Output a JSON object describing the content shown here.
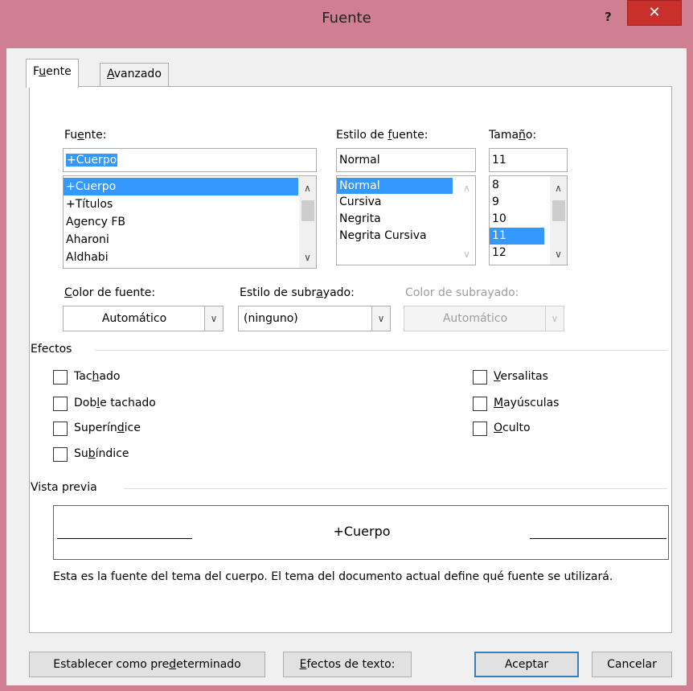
{
  "window": {
    "title": "Fuente",
    "help_label": "?",
    "close_label": "✕"
  },
  "tabs": [
    {
      "label_pre": "F",
      "label_u": "u",
      "label_post": "ente",
      "active": true
    },
    {
      "label_pre": "",
      "label_u": "A",
      "label_post": "vanzado",
      "active": false
    }
  ],
  "font": {
    "label_pre": "Fu",
    "label_u": "e",
    "label_post": "nte:",
    "value": "+Cuerpo",
    "items": [
      "+Cuerpo",
      "+Títulos",
      "Agency FB",
      "Aharoni",
      "Aldhabi"
    ],
    "selected_index": 0
  },
  "style": {
    "label_pre": "Estilo de ",
    "label_u": "f",
    "label_post": "uente:",
    "value": "Normal",
    "items": [
      "Normal",
      "Cursiva",
      "Negrita",
      "Negrita Cursiva"
    ],
    "selected_index": 0
  },
  "size": {
    "label_pre": "Tama",
    "label_u": "ñ",
    "label_post": "o:",
    "value": "11",
    "items": [
      "8",
      "9",
      "10",
      "11",
      "12"
    ],
    "selected_index": 3
  },
  "font_color": {
    "label_pre": "",
    "label_u": "C",
    "label_post": "olor de fuente:",
    "value": "Automático"
  },
  "underline_style": {
    "label_pre": "Estilo de subr",
    "label_u": "a",
    "label_post": "yado:",
    "value": "(ninguno)"
  },
  "underline_color": {
    "label": "Color de subrayado:",
    "value": "Automático"
  },
  "effects": {
    "heading": "Efectos",
    "left": [
      {
        "pre": "Tac",
        "u": "h",
        "post": "ado",
        "checked": false
      },
      {
        "pre": "Dob",
        "u": "l",
        "post": "e tachado",
        "checked": false
      },
      {
        "pre": "Superín",
        "u": "d",
        "post": "ice",
        "checked": false
      },
      {
        "pre": "Su",
        "u": "b",
        "post": "índice",
        "checked": false
      }
    ],
    "right": [
      {
        "pre": "",
        "u": "V",
        "post": "ersalitas",
        "checked": false
      },
      {
        "pre": "",
        "u": "M",
        "post": "ayúsculas",
        "checked": false
      },
      {
        "pre": "",
        "u": "O",
        "post": "culto",
        "checked": false
      }
    ]
  },
  "preview": {
    "heading": "Vista previa",
    "sample": "+Cuerpo",
    "description": "Esta es la fuente del tema del cuerpo. El tema del documento actual define qué fuente se utilizará."
  },
  "buttons": {
    "set_default": {
      "pre": "Establecer como pre",
      "u": "d",
      "post": "eterminado"
    },
    "text_effects": {
      "pre": "",
      "u": "E",
      "post": "fectos de texto:"
    },
    "ok": "Aceptar",
    "cancel": "Cancelar"
  },
  "colors": {
    "window_frame": "#cf7f8f",
    "close_button": "#c9302c",
    "selection": "#3399ff",
    "default_button_border": "#3c7fb1"
  }
}
